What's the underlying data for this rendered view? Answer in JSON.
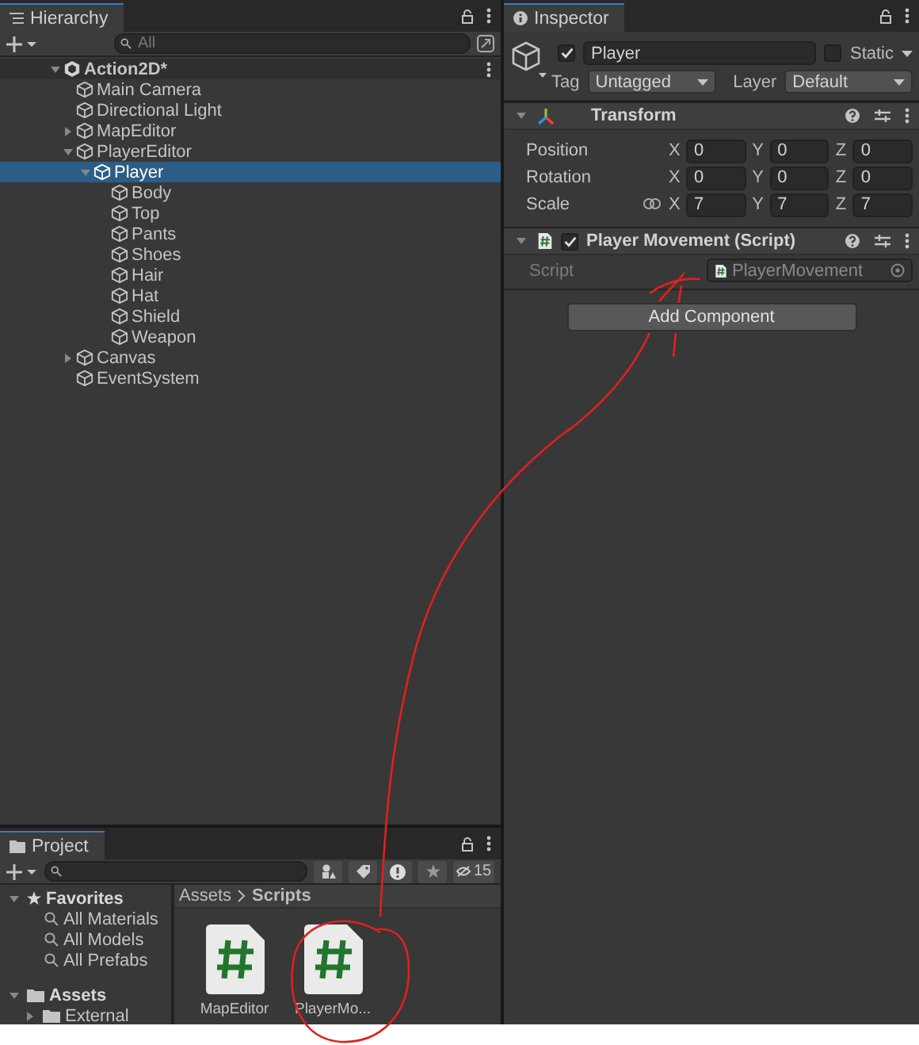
{
  "hierarchy": {
    "tab": "Hierarchy",
    "search_placeholder": "All",
    "scene": {
      "name": "Action2D*",
      "expanded": true
    },
    "items": [
      {
        "name": "Main Camera",
        "selected": false
      },
      {
        "name": "Directional Light",
        "selected": false
      },
      {
        "name": "MapEditor",
        "selected": false,
        "expanded": false
      },
      {
        "name": "PlayerEditor",
        "selected": false,
        "expanded": true,
        "children": [
          {
            "name": "Player",
            "selected": true,
            "expanded": true,
            "children": [
              {
                "name": "Body",
                "selected": false
              },
              {
                "name": "Top",
                "selected": false
              },
              {
                "name": "Pants",
                "selected": false
              },
              {
                "name": "Shoes",
                "selected": false
              },
              {
                "name": "Hair",
                "selected": false
              },
              {
                "name": "Hat",
                "selected": false
              },
              {
                "name": "Shield",
                "selected": false
              },
              {
                "name": "Weapon",
                "selected": false
              }
            ]
          }
        ]
      },
      {
        "name": "Canvas",
        "selected": false,
        "expanded": false
      },
      {
        "name": "EventSystem",
        "selected": false
      }
    ]
  },
  "inspector": {
    "tab": "Inspector",
    "object": {
      "active": true,
      "name": "Player",
      "static": false,
      "static_label": "Static",
      "tag_label": "Tag",
      "tag": "Untagged",
      "layer_label": "Layer",
      "layer": "Default"
    },
    "components": [
      {
        "kind": "transform",
        "title": "Transform",
        "expanded": true,
        "rows": [
          {
            "label": "Position",
            "link_icon": false,
            "axes": [
              {
                "axis": "X",
                "value": "0"
              },
              {
                "axis": "Y",
                "value": "0"
              },
              {
                "axis": "Z",
                "value": "0"
              }
            ]
          },
          {
            "label": "Rotation",
            "link_icon": false,
            "axes": [
              {
                "axis": "X",
                "value": "0"
              },
              {
                "axis": "Y",
                "value": "0"
              },
              {
                "axis": "Z",
                "value": "0"
              }
            ]
          },
          {
            "label": "Scale",
            "link_icon": true,
            "axes": [
              {
                "axis": "X",
                "value": "7"
              },
              {
                "axis": "Y",
                "value": "7"
              },
              {
                "axis": "Z",
                "value": "7"
              }
            ]
          }
        ]
      },
      {
        "kind": "script",
        "title": "Player Movement (Script)",
        "enabled": true,
        "expanded": true,
        "field_label": "Script",
        "field_value": "PlayerMovement"
      }
    ],
    "add_component": "Add Component"
  },
  "project": {
    "tab": "Project",
    "hidden_count": "15",
    "favorites": {
      "label": "Favorites",
      "expanded": true,
      "items": [
        "All Materials",
        "All Models",
        "All Prefabs"
      ]
    },
    "assets": {
      "label": "Assets",
      "expanded": true,
      "children": [
        {
          "name": "External",
          "expanded": false
        }
      ]
    },
    "breadcrumb": [
      "Assets",
      "Scripts"
    ],
    "files": [
      {
        "name": "MapEditor"
      },
      {
        "name": "PlayerMo..."
      }
    ]
  }
}
